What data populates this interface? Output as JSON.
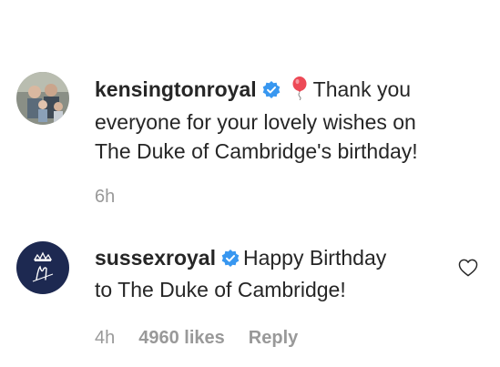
{
  "comments": [
    {
      "username": "kensingtonroyal",
      "verified_icon": "verified-badge-icon",
      "emoji": "balloon-icon",
      "body_line1": "Thank you",
      "body_line2": "everyone for your lovely wishes on",
      "body_line3": "The Duke of Cambridge's birthday!",
      "time": "6h"
    },
    {
      "username": "sussexroyal",
      "verified_icon": "verified-badge-icon",
      "body_line1": "Happy Birthday",
      "body_line2": "to The Duke of Cambridge!",
      "time": "4h",
      "likes": "4960 likes",
      "reply_label": "Reply",
      "like_icon": "heart-icon"
    }
  ],
  "colors": {
    "text": "#262626",
    "meta": "#999999",
    "verified": "#3897f0",
    "balloon": "#ed4956",
    "sussex_avatar_bg": "#1d2951"
  }
}
